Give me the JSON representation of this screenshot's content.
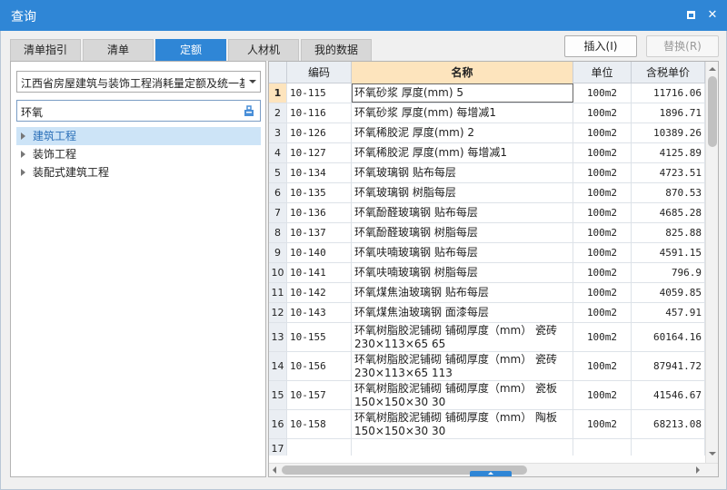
{
  "window": {
    "title": "查询"
  },
  "tabs": [
    {
      "label": "清单指引"
    },
    {
      "label": "清单"
    },
    {
      "label": "定额"
    },
    {
      "label": "人材机"
    },
    {
      "label": "我的数据"
    }
  ],
  "actions": {
    "insert": "插入(I)",
    "replace": "替换(R)"
  },
  "left": {
    "library": "江西省房屋建筑与装饰工程消耗量定额及统一基价表",
    "search_value": "环氧",
    "tree": [
      {
        "label": "建筑工程",
        "selected": true
      },
      {
        "label": "装饰工程",
        "selected": false
      },
      {
        "label": "装配式建筑工程",
        "selected": false
      }
    ]
  },
  "table": {
    "columns": {
      "code": "编码",
      "name": "名称",
      "unit": "单位",
      "price": "含税单价"
    },
    "rows": [
      {
        "n": "1",
        "code": "10-115",
        "name": "环氧砂浆 厚度(mm) 5",
        "unit": "100m2",
        "price": "11716.06"
      },
      {
        "n": "2",
        "code": "10-116",
        "name": "环氧砂浆 厚度(mm) 每增减1",
        "unit": "100m2",
        "price": "1896.71"
      },
      {
        "n": "3",
        "code": "10-126",
        "name": "环氧稀胶泥 厚度(mm) 2",
        "unit": "100m2",
        "price": "10389.26"
      },
      {
        "n": "4",
        "code": "10-127",
        "name": "环氧稀胶泥 厚度(mm) 每增减1",
        "unit": "100m2",
        "price": "4125.89"
      },
      {
        "n": "5",
        "code": "10-134",
        "name": "环氧玻璃钢 贴布每层",
        "unit": "100m2",
        "price": "4723.51"
      },
      {
        "n": "6",
        "code": "10-135",
        "name": "环氧玻璃钢 树脂每层",
        "unit": "100m2",
        "price": "870.53"
      },
      {
        "n": "7",
        "code": "10-136",
        "name": "环氧酚醛玻璃钢 贴布每层",
        "unit": "100m2",
        "price": "4685.28"
      },
      {
        "n": "8",
        "code": "10-137",
        "name": "环氧酚醛玻璃钢 树脂每层",
        "unit": "100m2",
        "price": "825.88"
      },
      {
        "n": "9",
        "code": "10-140",
        "name": "环氧呋喃玻璃钢 贴布每层",
        "unit": "100m2",
        "price": "4591.15"
      },
      {
        "n": "10",
        "code": "10-141",
        "name": "环氧呋喃玻璃钢 树脂每层",
        "unit": "100m2",
        "price": "796.9"
      },
      {
        "n": "11",
        "code": "10-142",
        "name": "环氧煤焦油玻璃钢 贴布每层",
        "unit": "100m2",
        "price": "4059.85"
      },
      {
        "n": "12",
        "code": "10-143",
        "name": "环氧煤焦油玻璃钢 面漆每层",
        "unit": "100m2",
        "price": "457.91"
      },
      {
        "n": "13",
        "code": "10-155",
        "name": "环氧树脂胶泥铺砌 铺砌厚度（mm） 瓷砖 230×113×65 65",
        "unit": "100m2",
        "price": "60164.16"
      },
      {
        "n": "14",
        "code": "10-156",
        "name": "环氧树脂胶泥铺砌 铺砌厚度（mm） 瓷砖 230×113×65 113",
        "unit": "100m2",
        "price": "87941.72"
      },
      {
        "n": "15",
        "code": "10-157",
        "name": "环氧树脂胶泥铺砌 铺砌厚度（mm） 瓷板 150×150×30 30",
        "unit": "100m2",
        "price": "41546.67"
      },
      {
        "n": "16",
        "code": "10-158",
        "name": "环氧树脂胶泥铺砌 铺砌厚度（mm） 陶板 150×150×30 30",
        "unit": "100m2",
        "price": "68213.08"
      },
      {
        "n": "17",
        "code": "",
        "name": "",
        "unit": "",
        "price": ""
      }
    ]
  },
  "icons": {
    "maximize": "maximize-icon",
    "close": "close-icon",
    "search": "search-icon"
  },
  "colors": {
    "titlebar": "#2f86d6",
    "active_tab": "#2f86d6",
    "selected_header": "#fde4bd"
  }
}
